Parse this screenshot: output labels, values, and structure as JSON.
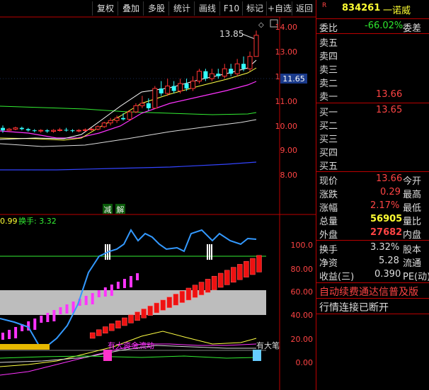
{
  "toolbar": {
    "buttons": [
      "复权",
      "叠加",
      "多股",
      "统计",
      "画线",
      "F10",
      "标记",
      "+自选",
      "返回"
    ]
  },
  "main_chart": {
    "price_axis": [
      "14.00",
      "13.00",
      "12.00",
      "11.00",
      "10.00",
      "9.00",
      "8.00"
    ],
    "current_price_tag": "11.65",
    "high_annotation": "13.85",
    "signal_label_1": "减",
    "signal_label_2": "解"
  },
  "sub_chart": {
    "header_value": "0.99",
    "header_turnover": "换手: 3.32",
    "axis": [
      "100.0",
      "80.00",
      "60.00",
      "40.00",
      "20.00",
      "0.00"
    ],
    "annotation_1": "有大资金流动",
    "annotation_2": "有大笔"
  },
  "quote": {
    "badge": "R",
    "code": "834261",
    "name": "一诺威",
    "wei_bi_label": "委比",
    "wei_bi_value": "-66.02%",
    "wei_cha_label": "委差",
    "sell5": "卖五",
    "sell4": "卖四",
    "sell3": "卖三",
    "sell2": "卖二",
    "sell1": "卖一",
    "sell1_price": "13.66",
    "buy1": "买一",
    "buy1_price": "13.65",
    "buy2": "买二",
    "buy3": "买三",
    "buy4": "买四",
    "buy5": "买五",
    "now_label": "现价",
    "now_value": "13.66",
    "open_label": "今开",
    "chg_label": "涨跌",
    "chg_value": "0.29",
    "high_label": "最高",
    "pct_label": "涨幅",
    "pct_value": "2.17%",
    "low_label": "最低",
    "vol_label": "总量",
    "vol_value": "56905",
    "volratio_label": "量比",
    "outer_label": "外盘",
    "outer_value": "27682",
    "inner_label": "内盘",
    "turnover_label": "换手",
    "turnover_value": "3.32%",
    "equity_label": "股本",
    "nav_label": "净资",
    "nav_value": "5.28",
    "float_label": "流通",
    "eps_label": "收益(三)",
    "eps_value": "0.390",
    "pe_label": "PE(动)",
    "ad_text": "自动续费通达信普及版",
    "status_text": "行情连接已断开"
  },
  "colors": {
    "up": "#ff3333",
    "down": "#33ffff",
    "ma_white": "#ffffff",
    "ma_yellow": "#ffff44",
    "ma_magenta": "#ff33ff",
    "ma_green": "#33ee33",
    "ma_blue": "#3344ff",
    "line_blue": "#3399ff"
  }
}
